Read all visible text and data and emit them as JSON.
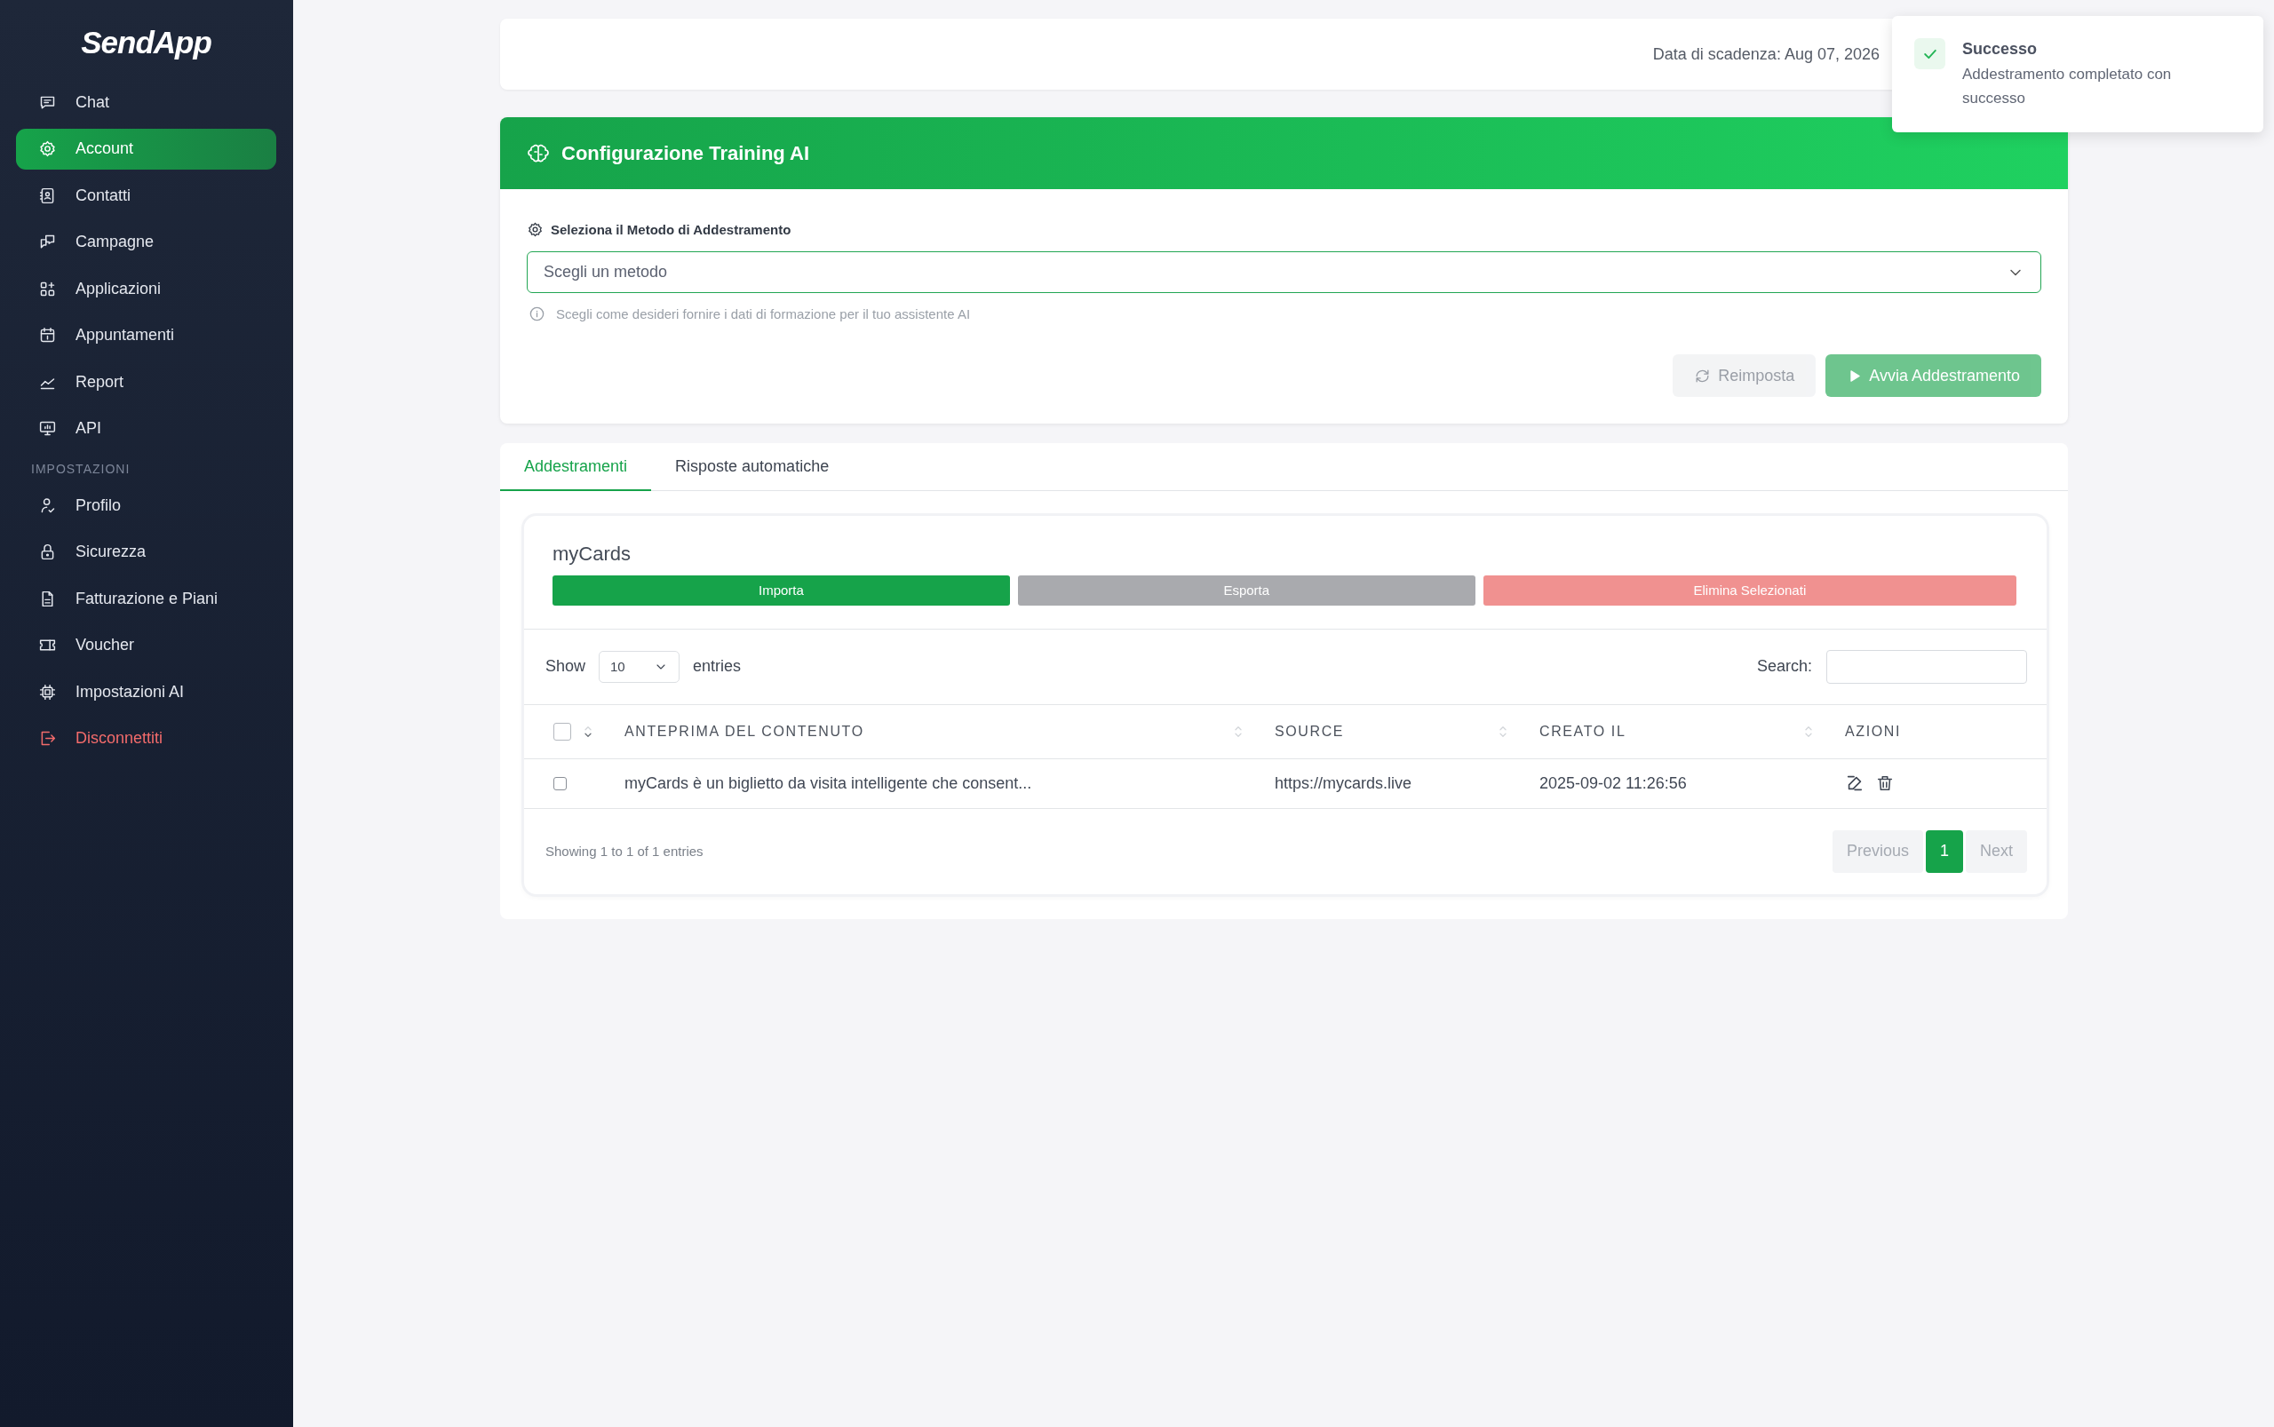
{
  "sidebar": {
    "logo": "SendApp",
    "groups": [
      {
        "items": [
          {
            "label": "Chat",
            "selected": false,
            "kind": "link"
          },
          {
            "label": "Account",
            "selected": true,
            "kind": "link"
          },
          {
            "label": "Contatti",
            "selected": false,
            "kind": "link"
          },
          {
            "label": "Campagne",
            "selected": false,
            "kind": "link"
          },
          {
            "label": "Applicazioni",
            "selected": false,
            "kind": "link"
          },
          {
            "label": "Appuntamenti",
            "selected": false,
            "kind": "link"
          },
          {
            "label": "Report",
            "selected": false,
            "kind": "link"
          },
          {
            "label": "API",
            "selected": false,
            "kind": "link"
          }
        ]
      },
      {
        "heading": "IMPOSTAZIONI",
        "items": [
          {
            "label": "Profilo",
            "selected": false,
            "kind": "link"
          },
          {
            "label": "Sicurezza",
            "selected": false,
            "kind": "link"
          },
          {
            "label": "Fatturazione e Piani",
            "selected": false,
            "kind": "link"
          },
          {
            "label": "Voucher",
            "selected": false,
            "kind": "link"
          },
          {
            "label": "Impostazioni AI",
            "selected": false,
            "kind": "link"
          },
          {
            "label": "Disconnettiti",
            "selected": false,
            "kind": "logout"
          }
        ]
      }
    ]
  },
  "topbar": {
    "expiry": "Data di scadenza: Aug 07, 2026"
  },
  "training": {
    "title": "Configurazione Training AI",
    "method_label": "Seleziona il Metodo di Addestramento",
    "method_select": {
      "placeholder": "Scegli un metodo"
    },
    "hint": "Scegli come desideri fornire i dati di formazione per il tuo assistente AI",
    "buttons": [
      {
        "label": "Reimposta",
        "kind": "reset",
        "disabled": true
      },
      {
        "label": "Avvia Addestramento",
        "kind": "start",
        "disabled": true
      }
    ]
  },
  "tabs": [
    {
      "label": "Addestramenti",
      "selected": true
    },
    {
      "label": "Risposte automatiche",
      "selected": false
    }
  ],
  "dataset": {
    "title": "myCards",
    "actions": [
      {
        "label": "Importa",
        "color": "#16a34a"
      },
      {
        "label": "Esporta",
        "color": "#a9aaae"
      },
      {
        "label": "Elimina Selezionati",
        "color": "#f09190"
      }
    ],
    "table": {
      "show_label": "Show",
      "page_length": "10",
      "entries_label": "entries",
      "search_label": "Search:",
      "select_all_checked": false,
      "columns": [
        {
          "label": "ANTEPRIMA DEL CONTENUTO",
          "sortable": true
        },
        {
          "label": "SOURCE",
          "sortable": true
        },
        {
          "label": "CREATO IL",
          "sortable": true
        },
        {
          "label": "AZIONI",
          "sortable": false
        }
      ],
      "rows": [
        {
          "checked": false,
          "cells": [
            "myCards è un biglietto da visita intelligente che consent...",
            "https://mycards.live",
            "2025-09-02 11:26:56"
          ]
        }
      ],
      "info": "Showing 1 to 1 of 1 entries",
      "previous": {
        "label": "Previous",
        "disabled": true
      },
      "pages": [
        {
          "label": "1",
          "selected": true
        }
      ],
      "next": {
        "label": "Next",
        "disabled": true
      }
    }
  },
  "toast": {
    "kind": "success",
    "title": "Successo",
    "message": "Addestramento completato con successo"
  }
}
